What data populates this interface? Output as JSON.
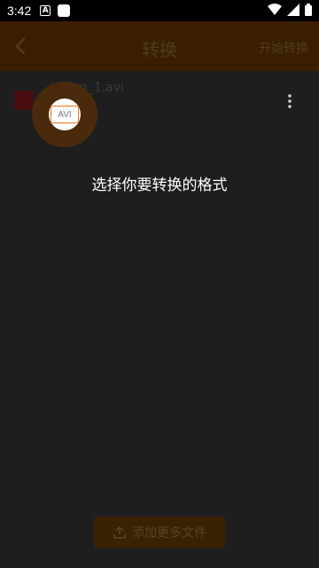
{
  "status_bar": {
    "time": "3:42",
    "notif_a": "A"
  },
  "app_bar": {
    "title": "转换",
    "action_label": "开始转换"
  },
  "file": {
    "name": "ipcam_1.avi"
  },
  "tooltip": {
    "format_label": "AVI",
    "hint": "选择你要转换的格式"
  },
  "bottom": {
    "add_more_label": "添加更多文件"
  },
  "colors": {
    "accent": "#e8761b",
    "app_bar_dim": "#3a1e02",
    "background": "#1e1e1e"
  }
}
